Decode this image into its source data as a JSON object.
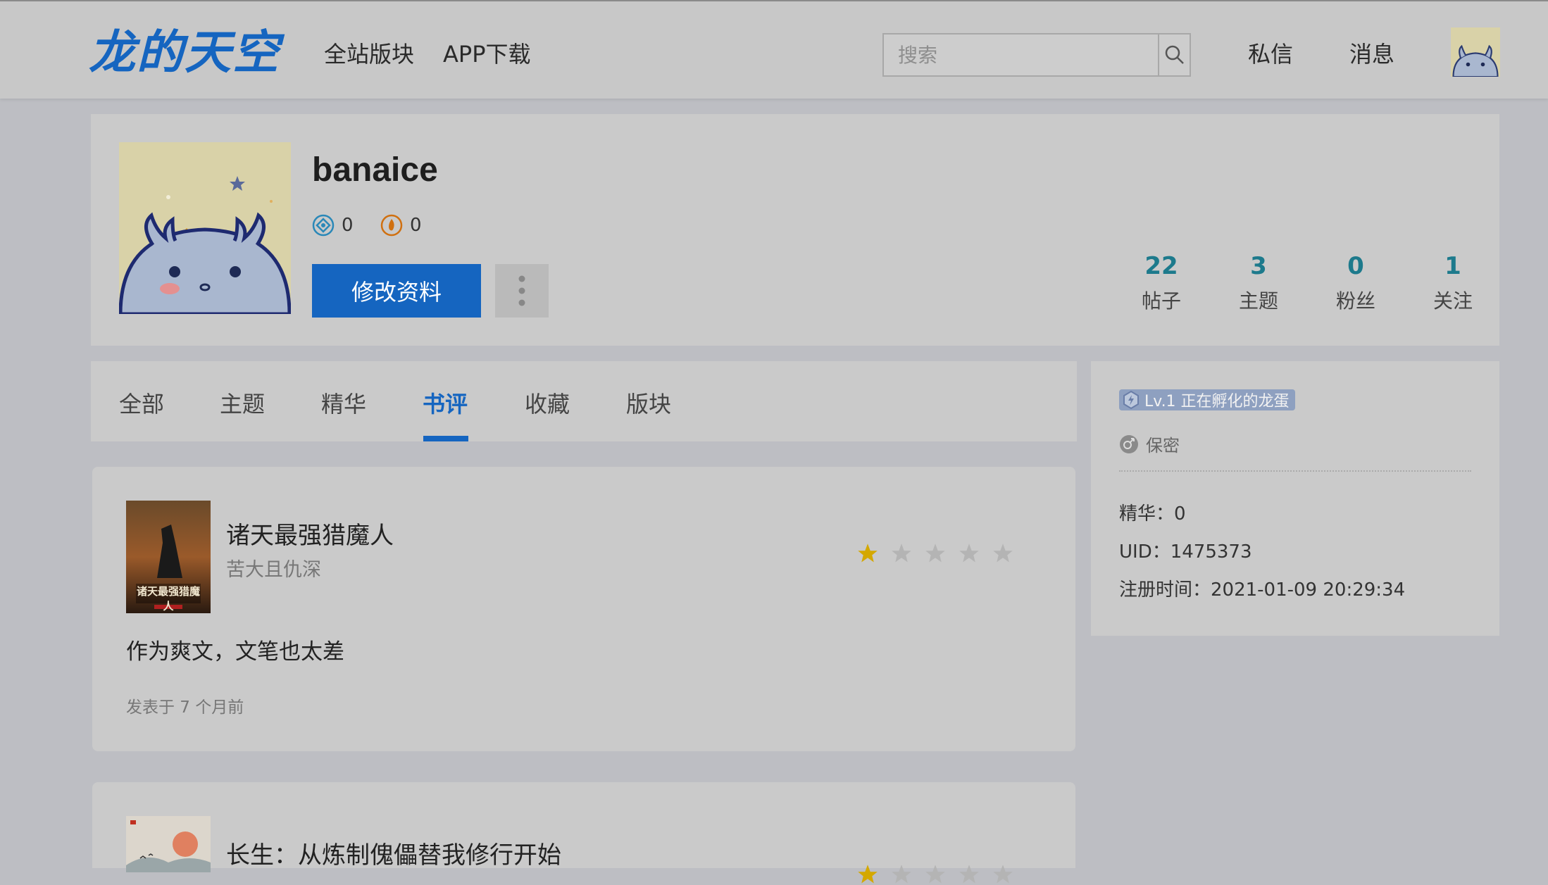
{
  "header": {
    "logo_text": "龙的天空",
    "nav": [
      "全站版块",
      "APP下载"
    ],
    "search_placeholder": "搜索",
    "messages_label": "私信",
    "notifications_label": "消息",
    "avatar_icon": "dragon-avatar-icon"
  },
  "profile": {
    "username": "banaice",
    "coin_a": "0",
    "coin_b": "0",
    "edit_label": "修改资料",
    "more_icon": "more-vertical-icon",
    "stats": [
      {
        "num": "22",
        "label": "帖子"
      },
      {
        "num": "3",
        "label": "主题"
      },
      {
        "num": "0",
        "label": "粉丝"
      },
      {
        "num": "1",
        "label": "关注"
      }
    ]
  },
  "tabs": [
    {
      "label": "全部"
    },
    {
      "label": "主题"
    },
    {
      "label": "精华"
    },
    {
      "label": "书评",
      "active": true
    },
    {
      "label": "收藏"
    },
    {
      "label": "版块"
    }
  ],
  "sidebar": {
    "level": "Lv.1 正在孵化的龙蛋",
    "privacy": "保密",
    "essence": "精华：0",
    "uid": "UID：1475373",
    "register": "注册时间：2021-01-09 20:29:34"
  },
  "reviews": [
    {
      "title": "诸天最强猎魔人",
      "author": "苦大且仇深",
      "rating": 1,
      "max_rating": 5,
      "text": "作为爽文，文笔也太差",
      "time": "发表于 7 个月前",
      "cover_text": "诸天最强猎魔人"
    },
    {
      "title": "长生：从炼制傀儡替我修行开始",
      "rating": 1,
      "max_rating": 5
    }
  ],
  "colors": {
    "brand": "#1565c0",
    "stat_number": "#1d7a8c",
    "star_active": "#d4a800",
    "star_inactive": "#b4b4b4"
  }
}
